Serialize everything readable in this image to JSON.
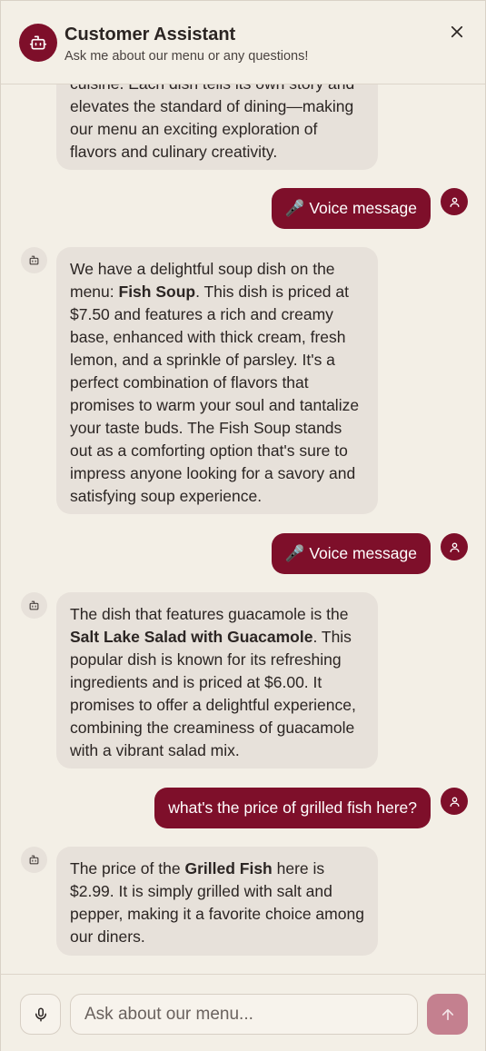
{
  "header": {
    "title": "Customer Assistant",
    "subtitle": "Ask me about our menu or any questions!",
    "avatar_icon": "robot-icon",
    "close_icon": "close-icon"
  },
  "messages": [
    {
      "role": "bot",
      "partial": true,
      "lines": [
        "cuisine. Each dish tells its own story and",
        "elevates the standard of dining—making",
        "our menu an exciting exploration of",
        "flavors and culinary creativity."
      ]
    },
    {
      "role": "user",
      "icon": "microphone-icon",
      "text": "Voice message"
    },
    {
      "role": "bot",
      "text_before": "We have a delightful soup dish on the menu: ",
      "bold": "Fish Soup",
      "text_after": ". This dish is priced at $7.50 and features a rich and creamy base, enhanced with thick cream, fresh lemon, and a sprinkle of parsley. It's a perfect combination of flavors that promises to warm your soul and tantalize your taste buds. The Fish Soup stands out as a comforting option that's sure to impress anyone looking for a savory and satisfying soup experience."
    },
    {
      "role": "user",
      "icon": "microphone-icon",
      "text": "Voice message"
    },
    {
      "role": "bot",
      "text_before": "The dish that features guacamole is the ",
      "bold": "Salt Lake Salad with Guacamole",
      "text_after": ". This popular dish is known for its refreshing ingredients and is priced at $6.00. It promises to offer a delightful experience, combining the creaminess of guacamole with a vibrant salad mix."
    },
    {
      "role": "user",
      "text": "what's the price of grilled fish here?"
    },
    {
      "role": "bot",
      "text_before": "The price of the ",
      "bold": "Grilled Fish",
      "text_after": " here is $2.99. It is simply grilled with salt and pepper, making it a favorite choice among our diners."
    }
  ],
  "input": {
    "placeholder": "Ask about our menu...",
    "value": "",
    "mic_icon": "microphone-icon",
    "send_icon": "arrow-up-icon"
  },
  "colors": {
    "accent": "#7e0f2a",
    "send_disabled": "#c4808f",
    "bot_bubble": "#e7e1da",
    "background": "#f3efe6"
  }
}
